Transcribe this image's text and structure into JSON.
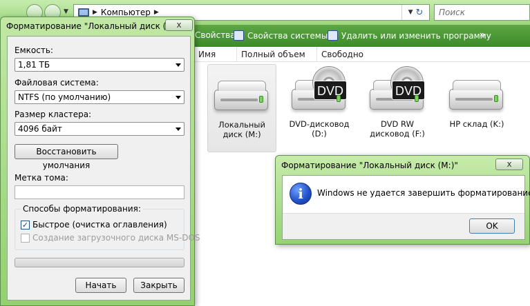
{
  "explorer": {
    "breadcrumb": "Компьютер",
    "search_placeholder": "Поиск",
    "toolbar": {
      "item1": "Свойства",
      "item2": "Свойства системы",
      "item3": "Удалить или изменить программу",
      "more": "»"
    },
    "columns": [
      "Имя",
      "Полный объем",
      "Свободно"
    ],
    "drives": [
      {
        "label": "Локальный диск (M:)",
        "kind": "hdd"
      },
      {
        "label": "DVD-дисковод (D:)",
        "kind": "dvd",
        "badge": "DVD"
      },
      {
        "label": "DVD RW дисковод (F:)",
        "kind": "dvd",
        "badge": "DVD"
      },
      {
        "label": "HP склад (K:)",
        "kind": "hdd"
      }
    ]
  },
  "format_dialog": {
    "title": "Форматирование \"Локальный диск (M:)\"",
    "close": "x",
    "capacity_label": "Емкость:",
    "capacity_value": "1,81 ТБ",
    "fs_label": "Файловая система:",
    "fs_value": "NTFS (по умолчанию)",
    "cluster_label": "Размер кластера:",
    "cluster_value": "4096 байт",
    "restore_button": "Восстановить умолчания",
    "volume_label": "Метка тома:",
    "volume_value": "",
    "options_title": "Способы форматирования:",
    "quick_label": "Быстрое (очистка оглавления)",
    "quick_checked": true,
    "msdos_label": "Создание загрузочного диска MS-DOS",
    "msdos_checked": false,
    "progress": 0,
    "start_button": "Начать",
    "close_button": "Закрыть"
  },
  "message": {
    "title": "Форматирование \"Локальный диск (M:)\"",
    "close": "x",
    "icon_glyph": "i",
    "text": "Windows не удается завершить форматирование.",
    "ok": "OK"
  }
}
